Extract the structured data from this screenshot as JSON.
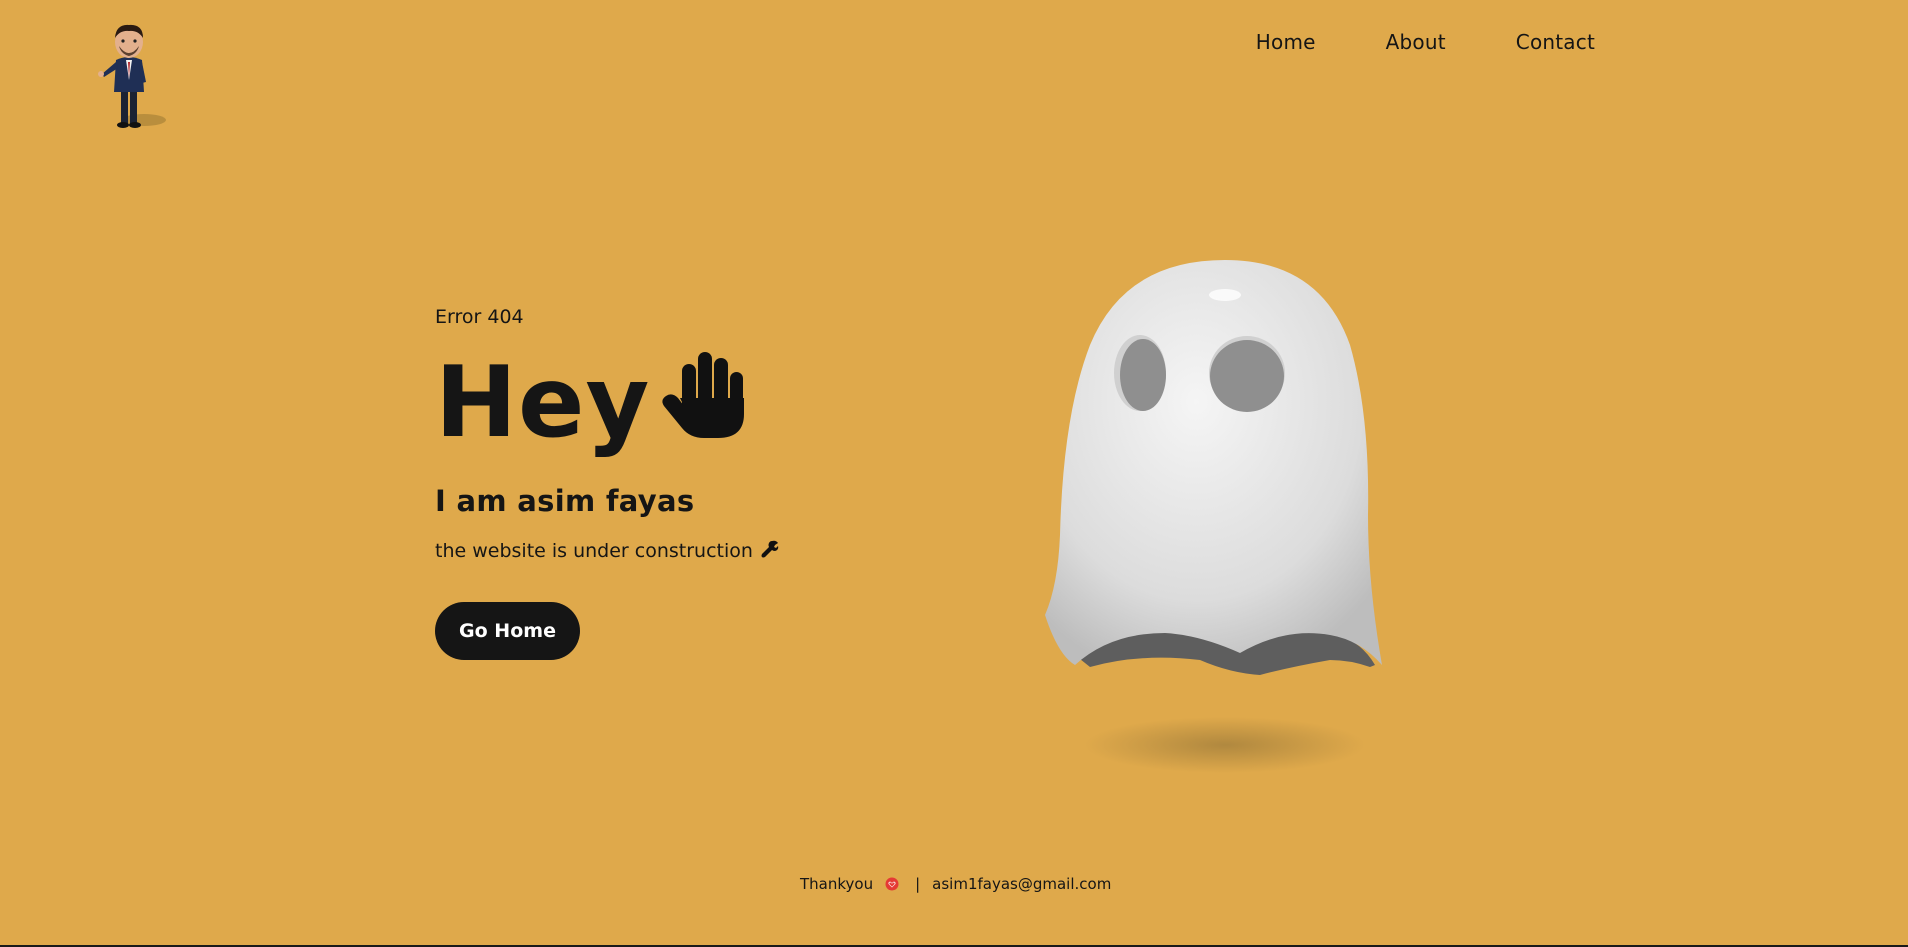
{
  "nav": {
    "items": [
      {
        "label": "Home"
      },
      {
        "label": "About"
      },
      {
        "label": "Contact"
      }
    ]
  },
  "hero": {
    "error_code": "Error 404",
    "greeting": "Hey",
    "name": "I am asim fayas",
    "subtitle": "the website is under construction",
    "button_label": "Go Home"
  },
  "footer": {
    "thanks": "Thankyou",
    "separator": "|",
    "email": "asim1fayas@gmail.com"
  },
  "colors": {
    "background": "#dfa94b",
    "text": "#151515",
    "button_bg": "#151515",
    "button_text": "#ffffff",
    "heart": "#e53935"
  },
  "icons": [
    "avatar-logo",
    "raised-hand-icon",
    "wrench-icon",
    "ghost-illustration",
    "heart-icon"
  ]
}
